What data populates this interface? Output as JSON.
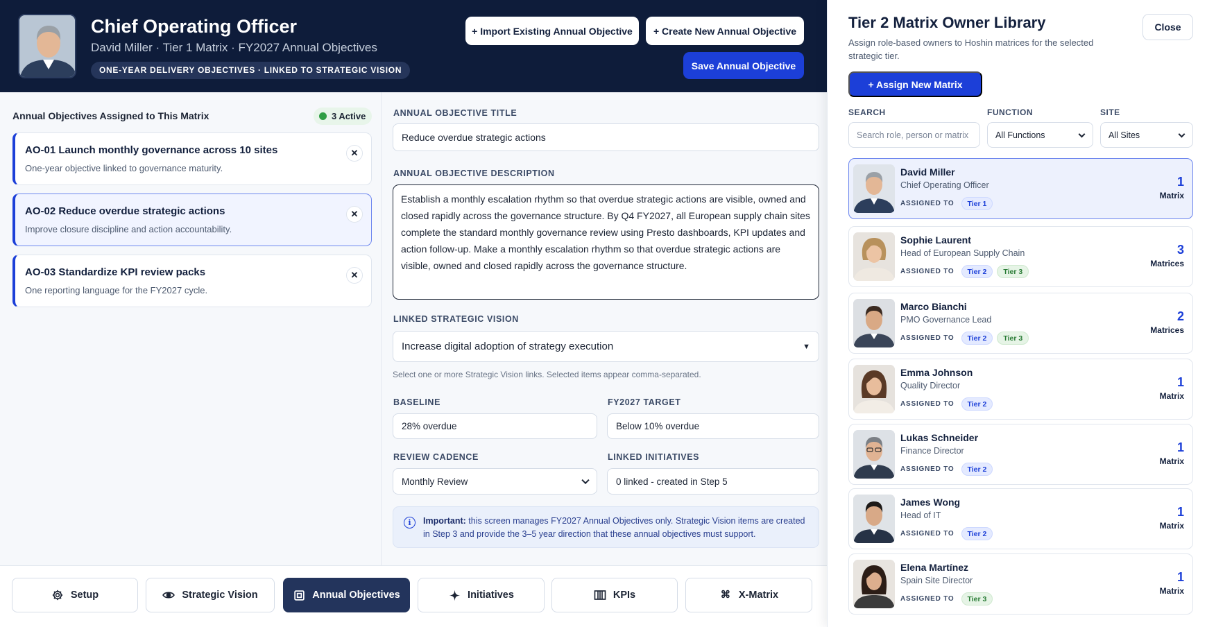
{
  "header": {
    "title": "Chief Operating Officer",
    "subtitle": "David Miller  ·  Tier 1 Matrix  ·  FY2027 Annual Objectives",
    "pill": "ONE-YEAR DELIVERY OBJECTIVES · LINKED TO STRATEGIC VISION",
    "import_label": "+ Import Existing Annual Objective",
    "create_label": "+ Create New Annual Objective",
    "save_label": "Save Annual Objective"
  },
  "objectives": {
    "heading": "Annual Objectives Assigned to This Matrix",
    "active_badge": "3 Active",
    "items": [
      {
        "title": "AO-01 Launch monthly governance across 10 sites",
        "desc": "One-year objective linked to governance maturity."
      },
      {
        "title": "AO-02 Reduce overdue strategic actions",
        "desc": "Improve closure discipline and action accountability."
      },
      {
        "title": "AO-03 Standardize KPI review packs",
        "desc": "One reporting language for the FY2027 cycle."
      }
    ]
  },
  "form": {
    "title_label": "ANNUAL OBJECTIVE TITLE",
    "title_value": "Reduce overdue strategic actions",
    "desc_label": "ANNUAL OBJECTIVE DESCRIPTION",
    "desc_value": "Establish a monthly escalation rhythm so that overdue strategic actions are visible, owned and closed rapidly across the governance structure. By Q4 FY2027, all European supply chain sites complete the standard monthly governance review using Presto dashboards, KPI updates and action follow-up. Make a monthly escalation rhythm so that overdue strategic actions are visible, owned and closed rapidly across the governance structure.",
    "vision_label": "LINKED STRATEGIC VISION",
    "vision_value": "Increase digital adoption of strategy execution",
    "vision_helper": "Select one or more Strategic Vision links. Selected items appear comma-separated.",
    "baseline_label": "BASELINE",
    "baseline_value": "28% overdue",
    "target_label": "FY2027 TARGET",
    "target_value": "Below 10% overdue",
    "cadence_label": "REVIEW CADENCE",
    "cadence_value": "Monthly Review",
    "initiatives_label": "LINKED INITIATIVES",
    "initiatives_value": "0 linked - created in Step 5",
    "info_strong": "Important:",
    "info_text": " this screen manages FY2027 Annual Objectives only. Strategic Vision items are created in Step 3 and provide the 3–5 year direction that these annual objectives must support."
  },
  "nav": {
    "items": [
      {
        "label": "Setup",
        "icon": "gear-icon"
      },
      {
        "label": "Strategic Vision",
        "icon": "eye-icon"
      },
      {
        "label": "Annual Objectives",
        "icon": "square-icon"
      },
      {
        "label": "Initiatives",
        "icon": "sparkle-icon"
      },
      {
        "label": "KPIs",
        "icon": "columns-icon"
      },
      {
        "label": "X-Matrix",
        "icon": "command-icon"
      }
    ]
  },
  "drawer": {
    "title": "Tier 2 Matrix Owner Library",
    "subtitle": "Assign role-based owners to Hoshin matrices for the selected strategic tier.",
    "close_label": "Close",
    "assign_label": "+ Assign New Matrix",
    "search_label": "SEARCH",
    "search_placeholder": "Search role, person or matrix",
    "function_label": "FUNCTION",
    "function_value": "All Functions",
    "site_label": "SITE",
    "site_value": "All Sites",
    "assigned_label": "ASSIGNED TO",
    "owners": [
      {
        "name": "David Miller",
        "role": "Chief Operating Officer",
        "tiers": [
          "Tier 1"
        ],
        "count": "1",
        "unit": "Matrix"
      },
      {
        "name": "Sophie Laurent",
        "role": "Head of European Supply Chain",
        "tiers": [
          "Tier 2",
          "Tier 3"
        ],
        "count": "3",
        "unit": "Matrices"
      },
      {
        "name": "Marco Bianchi",
        "role": "PMO Governance Lead",
        "tiers": [
          "Tier 2",
          "Tier 3"
        ],
        "count": "2",
        "unit": "Matrices"
      },
      {
        "name": "Emma Johnson",
        "role": "Quality Director",
        "tiers": [
          "Tier 2"
        ],
        "count": "1",
        "unit": "Matrix"
      },
      {
        "name": "Lukas Schneider",
        "role": "Finance Director",
        "tiers": [
          "Tier 2"
        ],
        "count": "1",
        "unit": "Matrix"
      },
      {
        "name": "James Wong",
        "role": "Head of IT",
        "tiers": [
          "Tier 2"
        ],
        "count": "1",
        "unit": "Matrix"
      },
      {
        "name": "Elena Martínez",
        "role": "Spain Site Director",
        "tiers": [
          "Tier 3"
        ],
        "count": "1",
        "unit": "Matrix"
      }
    ]
  },
  "colors": {
    "navy": "#0e1c3a",
    "accent_blue": "#1c3fd8",
    "tier_green": "#277a33",
    "active_green": "#2f9e44"
  }
}
